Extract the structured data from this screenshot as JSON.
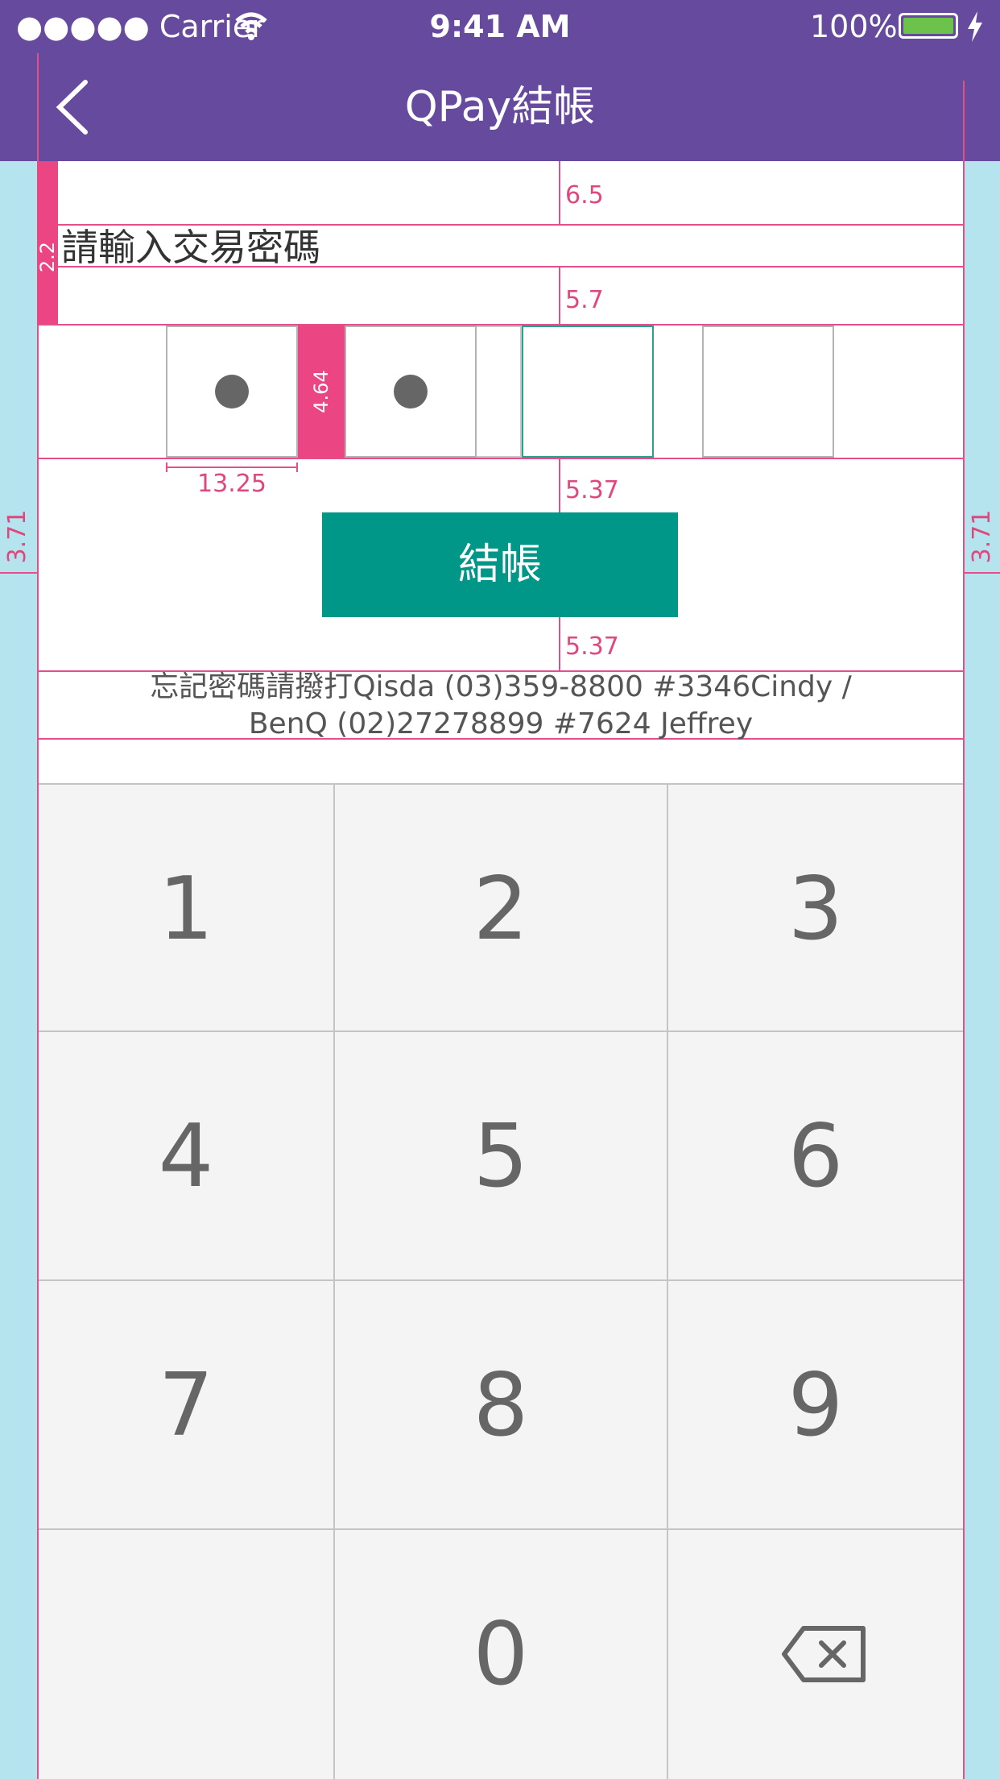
{
  "status_bar": {
    "carrier": "●●●●● Carrier",
    "time": "9:41 AM",
    "battery_percent": "100%"
  },
  "nav": {
    "title": "QPay結帳"
  },
  "prompt": "請輸入交易密碼",
  "pin": {
    "length": 4,
    "filled": 2
  },
  "pay_button": "結帳",
  "hint": {
    "line1": "忘記密碼請撥打Qisda (03)359-8800 #3346Cindy /",
    "line2": "BenQ (02)27278899 #7624 Jeffrey"
  },
  "keypad": {
    "keys": [
      "1",
      "2",
      "3",
      "4",
      "5",
      "6",
      "7",
      "8",
      "9",
      "",
      "0",
      "backspace"
    ]
  },
  "spec_annotations": {
    "top_gap": "6.5",
    "prompt_height": "2.2",
    "prompt_gap": "5.7",
    "pin_spacing": "4.64",
    "pin_width": "13.25",
    "button_gap_top": "5.37",
    "button_gap_bottom": "5.37",
    "side_margin_left": "3.71",
    "side_margin_right": "3.71"
  },
  "colors": {
    "brand": "#654a9e",
    "accent": "#009688",
    "spec": "#e0477f"
  }
}
